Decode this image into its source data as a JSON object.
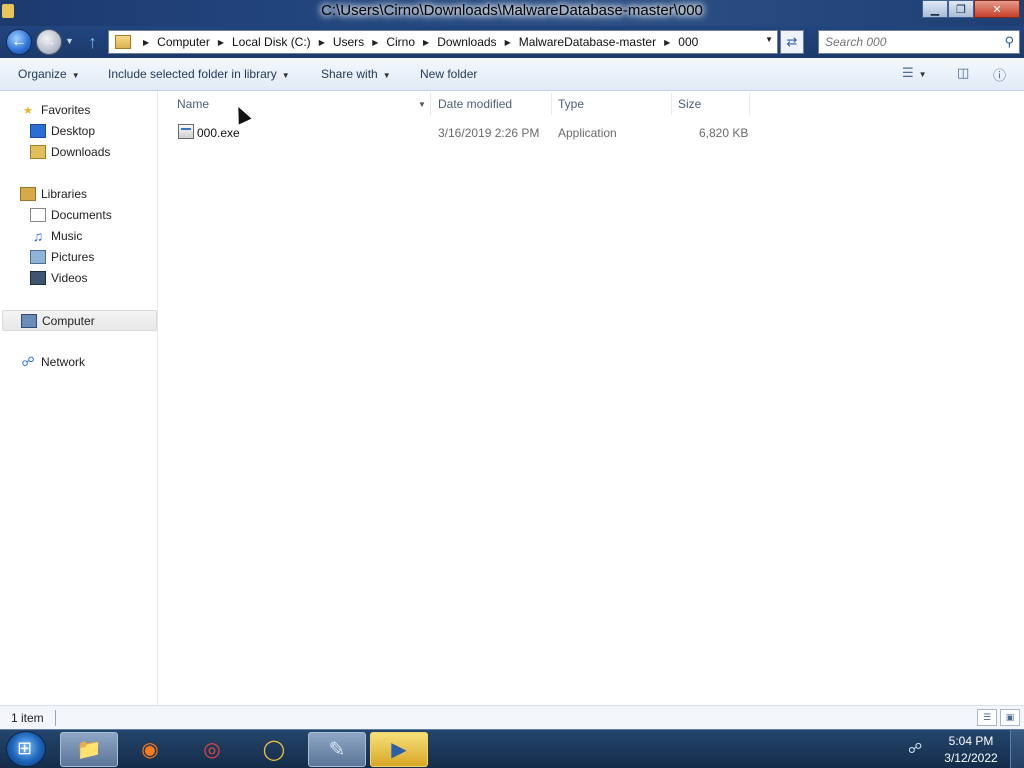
{
  "window": {
    "title": "C:\\Users\\Cirno\\Downloads\\MalwareDatabase-master\\000",
    "controls": {
      "minimize": "▁",
      "maximize": "❐",
      "close": "✕"
    }
  },
  "navigation": {
    "breadcrumbs": [
      "Computer",
      "Local Disk (C:)",
      "Users",
      "Cirno",
      "Downloads",
      "MalwareDatabase-master",
      "000"
    ],
    "search_placeholder": "Search 000"
  },
  "toolbar": {
    "organize": "Organize",
    "include_in_library": "Include selected folder in library",
    "share_with": "Share with",
    "new_folder": "New folder"
  },
  "sidebar": {
    "favorites": {
      "label": "Favorites",
      "items": [
        "Desktop",
        "Downloads"
      ]
    },
    "libraries": {
      "label": "Libraries",
      "items": [
        "Documents",
        "Music",
        "Pictures",
        "Videos"
      ]
    },
    "computer": "Computer",
    "network": "Network"
  },
  "file_list": {
    "columns": {
      "name": "Name",
      "date_modified": "Date modified",
      "type": "Type",
      "size": "Size"
    },
    "rows": [
      {
        "name": "000.exe",
        "date_modified": "3/16/2019 2:26 PM",
        "type": "Application",
        "size": "6,820 KB"
      }
    ]
  },
  "status": {
    "item_count": "1 item"
  },
  "taskbar": {
    "apps": [
      "windows-explorer",
      "firefox",
      "chrome",
      "norton-or-ring-app",
      "notepad-like-app",
      "media-player"
    ],
    "time": "5:04 PM",
    "date": "3/12/2022"
  },
  "colors": {
    "titlebar": "#1d3a6e",
    "toolbar": "#e1eaf6",
    "taskbar": "#142c49",
    "selection_highlight": "#f7e07a"
  }
}
